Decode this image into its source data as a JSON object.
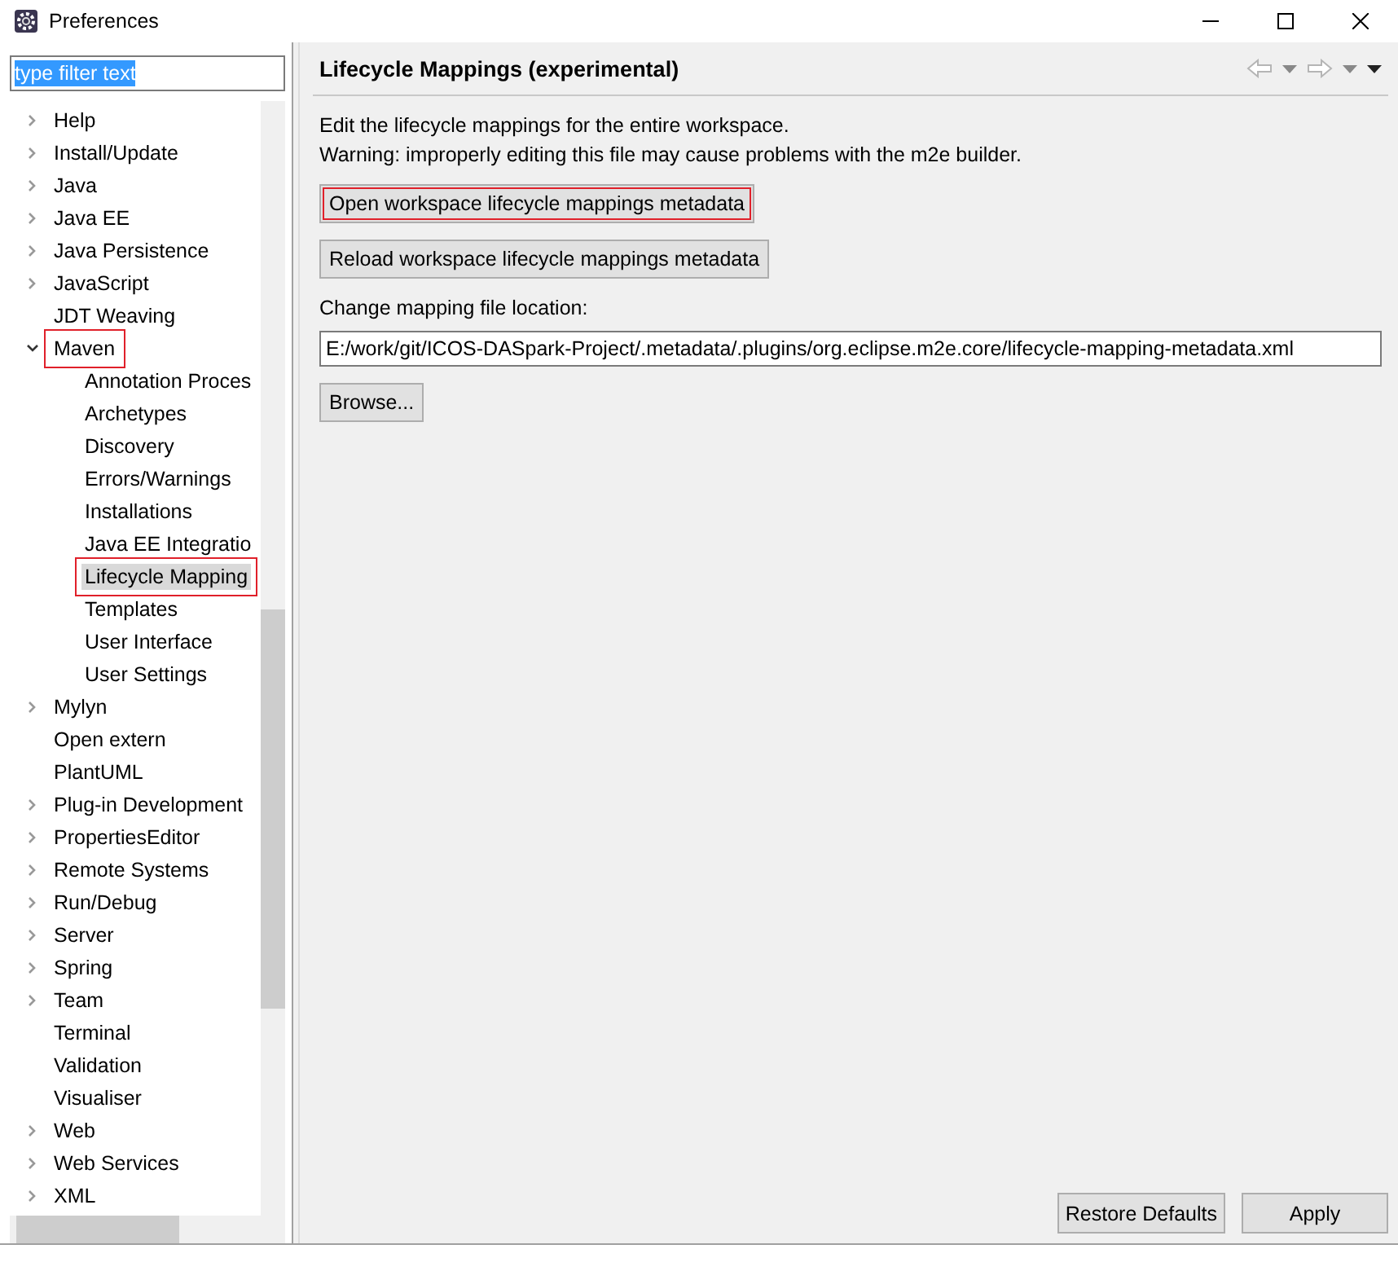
{
  "window": {
    "title": "Preferences"
  },
  "filter": {
    "value": "type filter text"
  },
  "tree": [
    {
      "label": "Help",
      "kind": "group",
      "expanded": false,
      "selected": false,
      "highlighted": false
    },
    {
      "label": "Install/Update",
      "kind": "group",
      "expanded": false,
      "selected": false,
      "highlighted": false
    },
    {
      "label": "Java",
      "kind": "group",
      "expanded": false,
      "selected": false,
      "highlighted": false
    },
    {
      "label": "Java EE",
      "kind": "group",
      "expanded": false,
      "selected": false,
      "highlighted": false
    },
    {
      "label": "Java Persistence",
      "kind": "group",
      "expanded": false,
      "selected": false,
      "highlighted": false
    },
    {
      "label": "JavaScript",
      "kind": "group",
      "expanded": false,
      "selected": false,
      "highlighted": false
    },
    {
      "label": "JDT Weaving",
      "kind": "leaf",
      "selected": false,
      "highlighted": false
    },
    {
      "label": "Maven",
      "kind": "group",
      "expanded": true,
      "selected": false,
      "highlighted": true,
      "children": [
        {
          "label": "Annotation Proces",
          "selected": false,
          "highlighted": false
        },
        {
          "label": "Archetypes",
          "selected": false,
          "highlighted": false
        },
        {
          "label": "Discovery",
          "selected": false,
          "highlighted": false
        },
        {
          "label": "Errors/Warnings",
          "selected": false,
          "highlighted": false
        },
        {
          "label": "Installations",
          "selected": false,
          "highlighted": false
        },
        {
          "label": "Java EE Integratio",
          "selected": false,
          "highlighted": false
        },
        {
          "label": "Lifecycle Mapping",
          "selected": true,
          "highlighted": true
        },
        {
          "label": "Templates",
          "selected": false,
          "highlighted": false
        },
        {
          "label": "User Interface",
          "selected": false,
          "highlighted": false
        },
        {
          "label": "User Settings",
          "selected": false,
          "highlighted": false
        }
      ]
    },
    {
      "label": "Mylyn",
      "kind": "group",
      "expanded": false,
      "selected": false,
      "highlighted": false
    },
    {
      "label": "Open extern",
      "kind": "leaf",
      "selected": false,
      "highlighted": false
    },
    {
      "label": "PlantUML",
      "kind": "leaf",
      "selected": false,
      "highlighted": false
    },
    {
      "label": "Plug-in Development",
      "kind": "group",
      "expanded": false,
      "selected": false,
      "highlighted": false
    },
    {
      "label": "PropertiesEditor",
      "kind": "group",
      "expanded": false,
      "selected": false,
      "highlighted": false
    },
    {
      "label": "Remote Systems",
      "kind": "group",
      "expanded": false,
      "selected": false,
      "highlighted": false
    },
    {
      "label": "Run/Debug",
      "kind": "group",
      "expanded": false,
      "selected": false,
      "highlighted": false
    },
    {
      "label": "Server",
      "kind": "group",
      "expanded": false,
      "selected": false,
      "highlighted": false
    },
    {
      "label": "Spring",
      "kind": "group",
      "expanded": false,
      "selected": false,
      "highlighted": false
    },
    {
      "label": "Team",
      "kind": "group",
      "expanded": false,
      "selected": false,
      "highlighted": false
    },
    {
      "label": "Terminal",
      "kind": "leaf",
      "selected": false,
      "highlighted": false
    },
    {
      "label": "Validation",
      "kind": "leaf",
      "selected": false,
      "highlighted": false
    },
    {
      "label": "Visualiser",
      "kind": "leaf",
      "selected": false,
      "highlighted": false
    },
    {
      "label": "Web",
      "kind": "group",
      "expanded": false,
      "selected": false,
      "highlighted": false
    },
    {
      "label": "Web Services",
      "kind": "group",
      "expanded": false,
      "selected": false,
      "highlighted": false
    },
    {
      "label": "XML",
      "kind": "group",
      "expanded": false,
      "selected": false,
      "highlighted": false
    }
  ],
  "page": {
    "title": "Lifecycle Mappings (experimental)",
    "description": [
      "Edit the lifecycle mappings for the entire workspace.",
      "Warning: improperly editing this file may cause problems with the m2e builder."
    ],
    "actions": [
      {
        "label": "Open workspace lifecycle mappings metadata",
        "highlighted": true
      },
      {
        "label": "Reload workspace lifecycle mappings metadata",
        "highlighted": false
      }
    ],
    "location_label": "Change mapping file location:",
    "location": "E:/work/git/ICOS-DASpark-Project/.metadata/.plugins/org.eclipse.m2e.core/lifecycle-mapping-metadata.xml",
    "browse": "Browse..."
  },
  "buttons": [
    "Restore Defaults",
    "Apply"
  ]
}
